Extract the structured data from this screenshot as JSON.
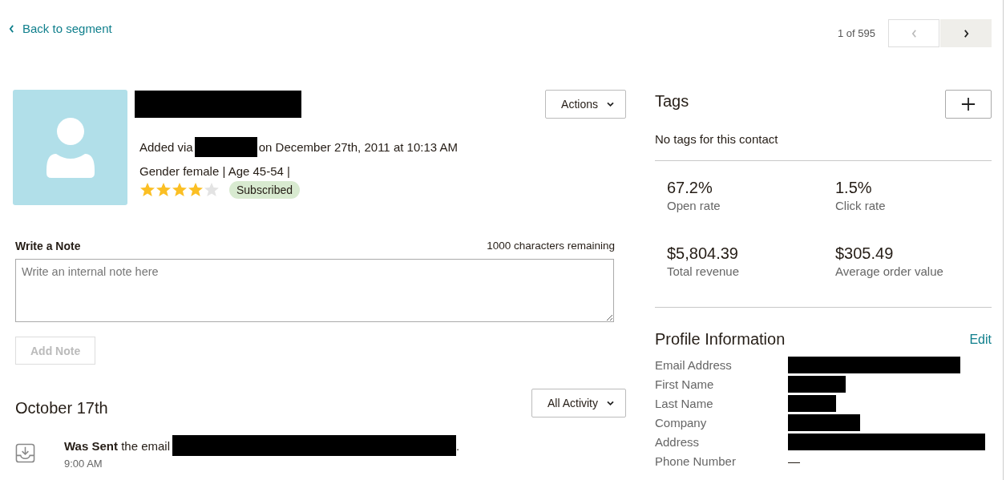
{
  "back_link": "Back to segment",
  "pager": {
    "position": "1 of 595",
    "prev_disabled": true,
    "next_disabled": false
  },
  "contact": {
    "name_redacted": true,
    "added_prefix": "Added via",
    "source_redacted": true,
    "added_suffix": "on December 27th, 2011 at 10:13 AM",
    "details": "Gender female | Age 45-54 |",
    "stars": 4,
    "status": "Subscribed",
    "actions_label": "Actions"
  },
  "note": {
    "title": "Write a Note",
    "remaining": "1000 characters remaining",
    "placeholder": "Write an internal note here",
    "button": "Add Note",
    "button_disabled": true
  },
  "activity": {
    "date": "October 17th",
    "filter": "All Activity",
    "events": [
      {
        "text": "**Was Sent** the email",
        "subject_redacted": true,
        "end": ".",
        "time": "9:00 AM"
      }
    ]
  },
  "tags": {
    "title": "Tags",
    "empty": "No tags for this contact"
  },
  "stats": [
    {
      "value": "67.2%",
      "label": "Open rate"
    },
    {
      "value": "1.5%",
      "label": "Click rate"
    },
    {
      "value": "$5,804.39",
      "label": "Total revenue"
    },
    {
      "value": "$305.49",
      "label": "Average order value"
    }
  ],
  "profile": {
    "title": "Profile Information",
    "edit": "Edit",
    "rows": [
      {
        "label": "Email Address",
        "redacted": true
      },
      {
        "label": "First Name",
        "redacted": true
      },
      {
        "label": "Last Name",
        "redacted": true
      },
      {
        "label": "Company",
        "redacted": true
      },
      {
        "label": "Address",
        "redacted": true
      },
      {
        "label": "Phone Number",
        "redacted": false,
        "value": "—"
      }
    ]
  }
}
